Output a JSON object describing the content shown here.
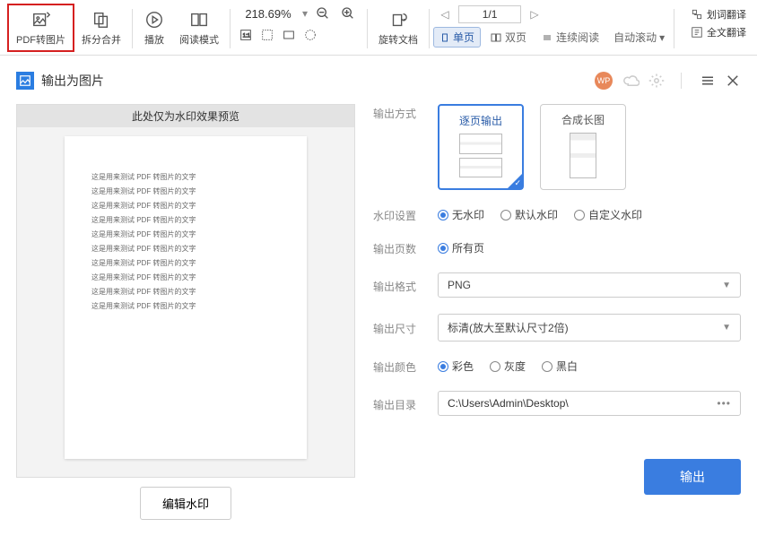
{
  "toolbar": {
    "pdf_to_image": "PDF转图片",
    "split_merge": "拆分合并",
    "play": "播放",
    "read_mode": "阅读模式",
    "zoom_value": "218.69%",
    "rotate_doc": "旋转文档",
    "page_indicator": "1/1",
    "view_single": "单页",
    "view_double": "双页",
    "view_continuous": "连续阅读",
    "auto_scroll": "自动滚动",
    "word_translate": "划词翻译",
    "full_translate": "全文翻译"
  },
  "panel": {
    "title": "输出为图片",
    "badge": "WP"
  },
  "preview": {
    "header": "此处仅为水印效果预览",
    "sample_line": "这是用来测试 PDF 转图片的文字",
    "edit_watermark": "编辑水印"
  },
  "form": {
    "output_mode": {
      "label": "输出方式",
      "per_page": "逐页输出",
      "long_image": "合成长图"
    },
    "watermark": {
      "label": "水印设置",
      "none": "无水印",
      "default": "默认水印",
      "custom": "自定义水印"
    },
    "pages": {
      "label": "输出页数",
      "all": "所有页"
    },
    "format": {
      "label": "输出格式",
      "value": "PNG"
    },
    "size": {
      "label": "输出尺寸",
      "value": "标清(放大至默认尺寸2倍)"
    },
    "color": {
      "label": "输出颜色",
      "color": "彩色",
      "gray": "灰度",
      "bw": "黑白"
    },
    "dir": {
      "label": "输出目录",
      "value": "C:\\Users\\Admin\\Desktop\\"
    },
    "submit": "输出"
  }
}
